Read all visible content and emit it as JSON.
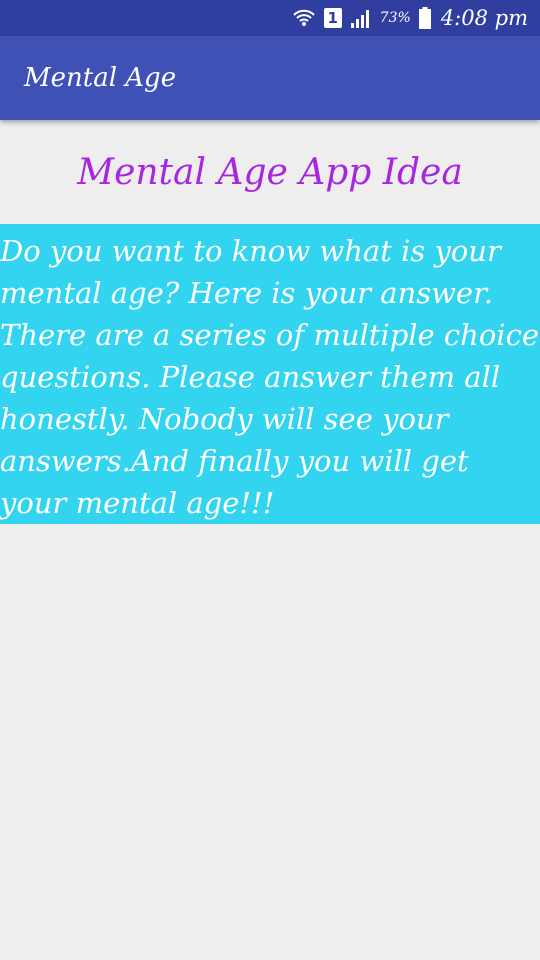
{
  "status_bar": {
    "sim_number": "1",
    "battery_percent": "73%",
    "time": "4:08 pm",
    "icons": [
      "wifi-icon",
      "sim-icon",
      "signal-icon",
      "battery-icon"
    ]
  },
  "app_bar": {
    "title": "Mental Age",
    "color": "#3f51b5"
  },
  "main": {
    "heading": "Mental Age App Idea",
    "heading_color": "#a727e0",
    "description": "Do you want to know what is your mental age? Here is your answer. There are a series of multiple choice questions. Please answer them all honestly. Nobody will see your answers.And finally you will get your mental age!!!",
    "description_bg": "#33d4ef"
  }
}
